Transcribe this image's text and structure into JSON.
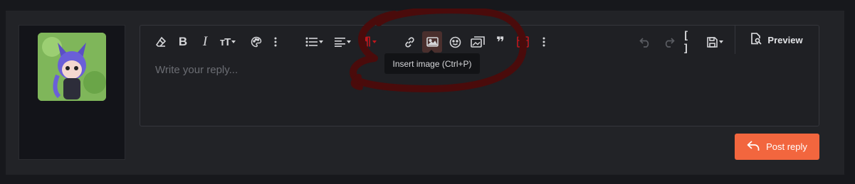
{
  "editor": {
    "placeholder": "Write your reply...",
    "preview_label": "Preview",
    "tooltip": "Insert image (Ctrl+P)"
  },
  "toolbar": {
    "buttons": [
      {
        "icon": "eraser-icon"
      },
      {
        "icon": "bold-icon"
      },
      {
        "icon": "italic-icon"
      },
      {
        "icon": "text-size-icon"
      },
      {
        "icon": "palette-icon"
      },
      {
        "icon": "more-vertical-icon"
      },
      {
        "icon": "list-icon"
      },
      {
        "icon": "align-icon"
      },
      {
        "icon": "paragraph-icon"
      },
      {
        "icon": "link-icon"
      },
      {
        "icon": "image-icon"
      },
      {
        "icon": "smiley-icon"
      },
      {
        "icon": "media-icon"
      },
      {
        "icon": "quote-icon"
      },
      {
        "icon": "spoiler-icon"
      },
      {
        "icon": "more-vertical-icon"
      },
      {
        "icon": "undo-icon"
      },
      {
        "icon": "redo-icon"
      },
      {
        "icon": "bbcode-toggle-icon"
      },
      {
        "icon": "drafts-icon"
      },
      {
        "icon": "preview-icon"
      }
    ]
  },
  "footer": {
    "post_label": "Post reply"
  },
  "colors": {
    "accent": "#f2663e",
    "annotation": "#4a0b0b"
  }
}
